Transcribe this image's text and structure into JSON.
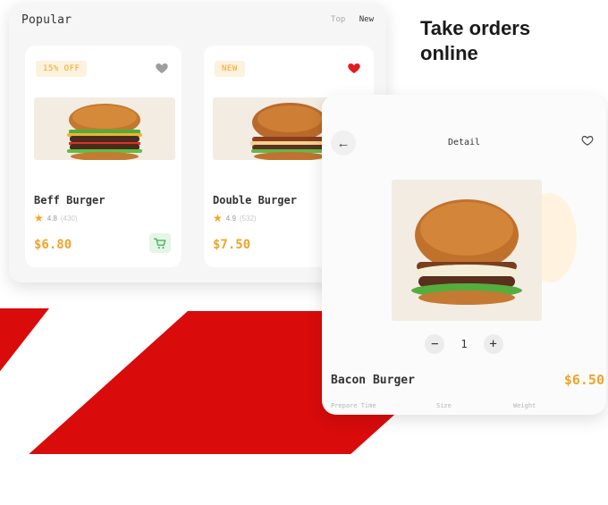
{
  "headline": {
    "line1": "Take orders",
    "line2": "online"
  },
  "popular": {
    "title": "Popular",
    "tabs": [
      "Top",
      "New"
    ],
    "items": [
      {
        "badge": "15% OFF",
        "name": "Beff Burger",
        "rating": "4.8",
        "reviews": "(430)",
        "price": "$6.80",
        "favorite": false
      },
      {
        "badge": "NEW",
        "name": "Double Burger",
        "rating": "4.9",
        "reviews": "(532)",
        "price": "$7.50",
        "favorite": true
      }
    ]
  },
  "detail": {
    "title": "Detail",
    "quantity": "1",
    "name": "Bacon Burger",
    "price": "$6.50",
    "meta": [
      "Prepare Time",
      "Size",
      "Weight"
    ]
  },
  "colors": {
    "accent": "#f0a52a",
    "heart_active": "#e31b23",
    "heart_inactive": "#9e9e9e",
    "stripe": "#d90b0b",
    "cart_bg": "#e4f6e6",
    "cart_icon": "#3fae57"
  },
  "icons": {
    "back": "arrow-left-icon",
    "favorite": "heart-icon",
    "star": "star-icon",
    "cart": "cart-icon",
    "minus": "minus-icon",
    "plus": "plus-icon"
  }
}
